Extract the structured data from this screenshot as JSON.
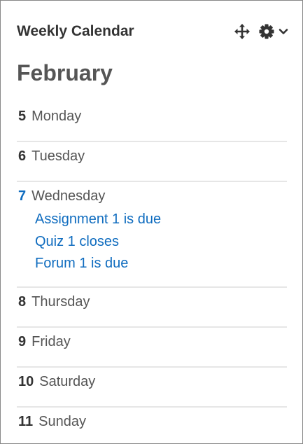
{
  "block": {
    "title": "Weekly Calendar",
    "controls": {
      "move": "move-icon",
      "settings": "gear-icon",
      "menu": "chevron-down-icon"
    }
  },
  "calendar": {
    "month": "February",
    "days": [
      {
        "number": "5",
        "name": "Monday",
        "events": []
      },
      {
        "number": "6",
        "name": "Tuesday",
        "events": []
      },
      {
        "number": "7",
        "name": "Wednesday",
        "today": true,
        "events": [
          "Assignment 1 is due",
          "Quiz 1 closes",
          "Forum 1 is due"
        ]
      },
      {
        "number": "8",
        "name": "Thursday",
        "events": []
      },
      {
        "number": "9",
        "name": "Friday",
        "events": []
      },
      {
        "number": "10",
        "name": "Saturday",
        "events": []
      },
      {
        "number": "11",
        "name": "Sunday",
        "events": []
      }
    ]
  },
  "colors": {
    "link": "#0f6cbf",
    "title": "#333333",
    "month": "#555555",
    "divider": "#e6e6e6",
    "border": "#888888"
  }
}
